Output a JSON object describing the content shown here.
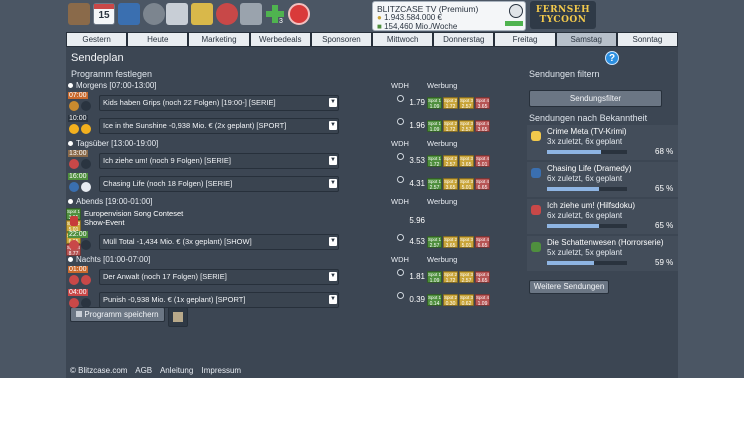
{
  "colors": {
    "frame": "#4b5664",
    "panel": "#3c4653",
    "accent_blue": "#2b8fe0",
    "ad_green": "#4f8f3e",
    "ad_yellow": "#c9a53a",
    "ad_red": "#b65454",
    "progress": "#8fb5e3"
  },
  "toolbar": {
    "icons": [
      "film-stack-icon",
      "calendar-icon",
      "archive-icon",
      "film-reels-icon",
      "script-icon",
      "contract-icon",
      "ads-icon",
      "building-icon",
      "add-icon",
      "power-icon"
    ],
    "calendar_day": "15",
    "add_badge": "3"
  },
  "status": {
    "station": "BLITZCASE TV (Premium)",
    "money": "1.943.584.000 €",
    "weekly": "154,460 Mio./Woche"
  },
  "logo": {
    "line1": "FERNSEH",
    "line2": "TYCOON"
  },
  "tabs": [
    {
      "label": "Gestern"
    },
    {
      "label": "Heute"
    },
    {
      "label": "Marketing"
    },
    {
      "label": "Werbedeals"
    },
    {
      "label": "Sponsoren"
    },
    {
      "label": "Mittwoch"
    },
    {
      "label": "Donnerstag"
    },
    {
      "label": "Freitag"
    },
    {
      "label": "Samstag",
      "active": true
    },
    {
      "label": "Sonntag"
    }
  ],
  "page": {
    "title": "Sendeplan",
    "section_title": "Programm festlegen",
    "wdh_label": "WDH",
    "werbung_label": "Werbung"
  },
  "blocks": [
    {
      "label": "Morgens [07:00-13:00]",
      "rows": [
        {
          "time": "07:00",
          "program": "Kids haben Grips (noch 22 Folgen) [19:00-] [SERIE]",
          "wdh": "1.79",
          "ads": [
            [
              "Spot 1",
              "1.09"
            ],
            [
              "Spot 2",
              "1.72"
            ],
            [
              "Spot 3",
              "2.57"
            ],
            [
              "Spot 4",
              "3.65"
            ]
          ]
        },
        {
          "time": "10:00",
          "program": "Ice in the Sunshine -0,938 Mio. € (2x geplant) [SPORT]",
          "wdh": "1.96",
          "ads": [
            [
              "Spot 1",
              "1.09"
            ],
            [
              "Spot 2",
              "1.72"
            ],
            [
              "Spot 3",
              "2.57"
            ],
            [
              "Spot 4",
              "3.65"
            ]
          ]
        }
      ]
    },
    {
      "label": "Tagsüber [13:00-19:00]",
      "rows": [
        {
          "time": "13:00",
          "program": "Ich ziehe um! (noch 9 Folgen) [SERIE]",
          "wdh": "3.53",
          "ads": [
            [
              "Spot 1",
              "1.72"
            ],
            [
              "Spot 2",
              "2.57"
            ],
            [
              "Spot 3",
              "3.65"
            ],
            [
              "Spot 4",
              "5.01"
            ]
          ]
        },
        {
          "time": "16:00",
          "program": "Chasing Life (noch 18 Folgen) [SERIE]",
          "wdh": "4.31",
          "ads": [
            [
              "Spot 1",
              "2.57"
            ],
            [
              "Spot 2",
              "3.65"
            ],
            [
              "Spot 3",
              "5.01"
            ],
            [
              "Spot 4",
              "6.65"
            ]
          ]
        }
      ]
    },
    {
      "label": "Abends [19:00-01:00]",
      "special": {
        "title": "Europenvision Song Conteset",
        "subtitle": "Show-Event",
        "wdh": "5.96",
        "ads": [
          [
            "Spot 1",
            "3.65"
          ],
          [
            "Spot 2",
            "5.01"
          ],
          [
            "Spot 3",
            "6.65"
          ],
          [
            "Spot 4",
            "8.77"
          ]
        ]
      },
      "rows": [
        {
          "time": "22:00",
          "program": "Müll Total -1,434 Mio. € (3x geplant) [SHOW]",
          "wdh": "4.53",
          "ads": [
            [
              "Spot 1",
              "2.57"
            ],
            [
              "Spot 2",
              "3.65"
            ],
            [
              "Spot 3",
              "5.01"
            ],
            [
              "Spot 4",
              "6.65"
            ]
          ]
        }
      ]
    },
    {
      "label": "Nachts [01:00-07:00]",
      "rows": [
        {
          "time": "01:00",
          "program": "Der Anwalt (noch 17 Folgen) [SERIE]",
          "wdh": "1.81",
          "ads": [
            [
              "Spot 1",
              "1.09"
            ],
            [
              "Spot 2",
              "1.72"
            ],
            [
              "Spot 3",
              "2.57"
            ],
            [
              "Spot 4",
              "3.65"
            ]
          ]
        },
        {
          "time": "04:00",
          "program": "Punish -0,938 Mio. € (1x geplant) [SPORT]",
          "wdh": "0.39",
          "ads": [
            [
              "Spot 1",
              "0.14"
            ],
            [
              "Spot 2",
              "0.30"
            ],
            [
              "Spot 3",
              "0.62"
            ],
            [
              "Spot 4",
              "1.09"
            ]
          ]
        }
      ]
    }
  ],
  "save_button": "Programm speichern",
  "sidebar": {
    "filter_title": "Sendungen filtern",
    "filter_button": "Sendungsfilter",
    "fame_title": "Sendungen nach Bekanntheit",
    "shows": [
      {
        "name": "Crime Meta (TV-Krimi)",
        "sub": "3x zuletzt, 6x geplant",
        "pct_label": "68 %",
        "pct": 0.68,
        "icon": "badge-icon"
      },
      {
        "name": "Chasing Life (Dramedy)",
        "sub": "6x zuletzt, 6x geplant",
        "pct_label": "65 %",
        "pct": 0.65,
        "icon": "person-icon"
      },
      {
        "name": "Ich ziehe um! (Hilfsdoku)",
        "sub": "6x zuletzt, 6x geplant",
        "pct_label": "65 %",
        "pct": 0.65,
        "icon": "mover-icon"
      },
      {
        "name": "Die Schattenwesen (Horrorserie)",
        "sub": "5x zuletzt, 5x geplant",
        "pct_label": "59 %",
        "pct": 0.59,
        "icon": "monster-icon"
      }
    ],
    "more_button": "Weitere Sendungen"
  },
  "footer": {
    "copyright": "© Blitzcase.com",
    "agb": "AGB",
    "anleitung": "Anleitung",
    "impressum": "Impressum"
  }
}
